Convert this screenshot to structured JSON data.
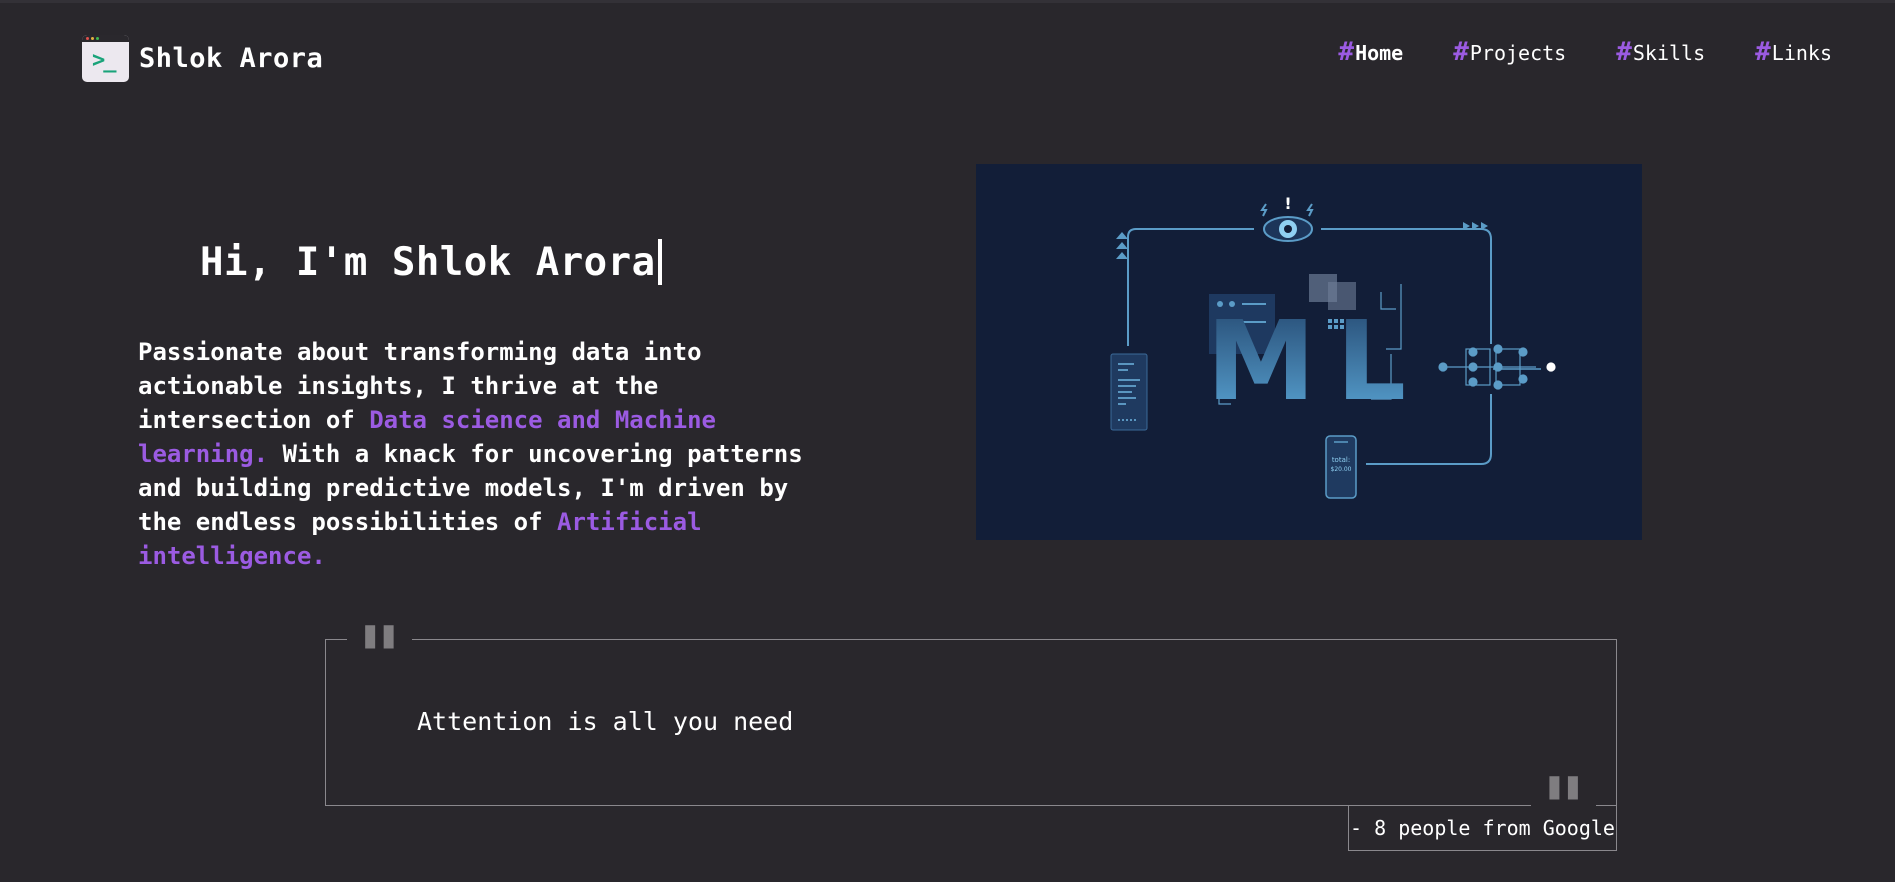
{
  "header": {
    "logo_text": "Shlok Arora",
    "logo_icon": "terminal-icon",
    "nav": [
      {
        "hash": "#",
        "label": "Home"
      },
      {
        "hash": "#",
        "label": "Projects"
      },
      {
        "hash": "#",
        "label": "Skills"
      },
      {
        "hash": "#",
        "label": "Links"
      }
    ]
  },
  "hero": {
    "title": "Hi, I'm Shlok Arora",
    "desc_part1": "Passionate about transforming data into actionable insights, I thrive at the intersection of ",
    "desc_highlight1": "Data science and Machine learning.",
    "desc_part2": " With a knack for uncovering patterns and building predictive models, I'm driven by the endless possibilities of ",
    "desc_highlight2": "Artificial intelligence.",
    "illustration": {
      "letters": [
        "M",
        "L"
      ],
      "phone_total_label": "total:",
      "phone_total_value": "$20.00",
      "exclaim": "!"
    }
  },
  "quote": {
    "text": "Attention is all you need",
    "author": "- 8 people from Google",
    "open_mark": "\"",
    "close_mark": "\""
  },
  "colors": {
    "background": "#29272c",
    "accent": "#9b5be2",
    "image_bg": "#121e38",
    "line": "#5b9cc7"
  }
}
